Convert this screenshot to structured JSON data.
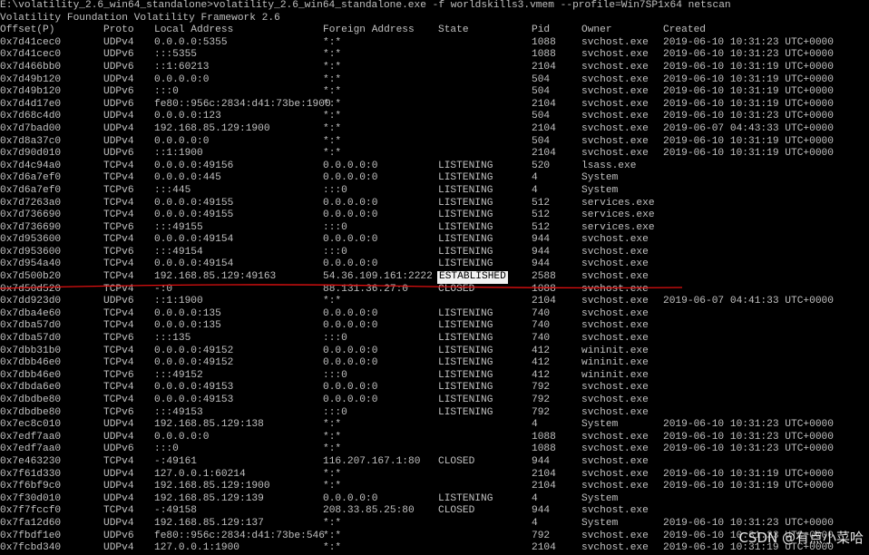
{
  "command": "E:\\volatility_2.6_win64_standalone>volatility_2.6_win64_standalone.exe -f worldskills3.vmem --profile=Win7SP1x64 netscan",
  "banner": "Volatility Foundation Volatility Framework 2.6",
  "headers": [
    "Offset(P)",
    "Proto",
    "Local Address",
    "Foreign Address",
    "State",
    "Pid",
    "Owner",
    "Created"
  ],
  "rows": [
    [
      "0x7d41cec0",
      "UDPv4",
      "0.0.0.0:5355",
      "*:*",
      "",
      "1088",
      "svchost.exe",
      "2019-06-10 10:31:23 UTC+0000"
    ],
    [
      "0x7d41cec0",
      "UDPv6",
      ":::5355",
      "*:*",
      "",
      "1088",
      "svchost.exe",
      "2019-06-10 10:31:23 UTC+0000"
    ],
    [
      "0x7d466bb0",
      "UDPv6",
      "::1:60213",
      "*:*",
      "",
      "2104",
      "svchost.exe",
      "2019-06-10 10:31:19 UTC+0000"
    ],
    [
      "0x7d49b120",
      "UDPv4",
      "0.0.0.0:0",
      "*:*",
      "",
      "504",
      "svchost.exe",
      "2019-06-10 10:31:19 UTC+0000"
    ],
    [
      "0x7d49b120",
      "UDPv6",
      ":::0",
      "*:*",
      "",
      "504",
      "svchost.exe",
      "2019-06-10 10:31:19 UTC+0000"
    ],
    [
      "0x7d4d17e0",
      "UDPv6",
      "fe80::956c:2834:d41:73be:1900",
      "*:*",
      "",
      "2104",
      "svchost.exe",
      "2019-06-10 10:31:19 UTC+0000"
    ],
    [
      "0x7d68c4d0",
      "UDPv4",
      "0.0.0.0:123",
      "*:*",
      "",
      "504",
      "svchost.exe",
      "2019-06-10 10:31:23 UTC+0000"
    ],
    [
      "0x7d7bad00",
      "UDPv4",
      "192.168.85.129:1900",
      "*:*",
      "",
      "2104",
      "svchost.exe",
      "2019-06-07 04:43:33 UTC+0000"
    ],
    [
      "0x7d8a37c0",
      "UDPv4",
      "0.0.0.0:0",
      "*:*",
      "",
      "504",
      "svchost.exe",
      "2019-06-10 10:31:19 UTC+0000"
    ],
    [
      "0x7d90d010",
      "UDPv6",
      "::1:1900",
      "*:*",
      "",
      "2104",
      "svchost.exe",
      "2019-06-10 10:31:19 UTC+0000"
    ],
    [
      "0x7d4c94a0",
      "TCPv4",
      "0.0.0.0:49156",
      "0.0.0.0:0",
      "LISTENING",
      "520",
      "lsass.exe",
      ""
    ],
    [
      "0x7d6a7ef0",
      "TCPv4",
      "0.0.0.0:445",
      "0.0.0.0:0",
      "LISTENING",
      "4",
      "System",
      ""
    ],
    [
      "0x7d6a7ef0",
      "TCPv6",
      ":::445",
      ":::0",
      "LISTENING",
      "4",
      "System",
      ""
    ],
    [
      "0x7d7263a0",
      "TCPv4",
      "0.0.0.0:49155",
      "0.0.0.0:0",
      "LISTENING",
      "512",
      "services.exe",
      ""
    ],
    [
      "0x7d736690",
      "TCPv4",
      "0.0.0.0:49155",
      "0.0.0.0:0",
      "LISTENING",
      "512",
      "services.exe",
      ""
    ],
    [
      "0x7d736690",
      "TCPv6",
      ":::49155",
      ":::0",
      "LISTENING",
      "512",
      "services.exe",
      ""
    ],
    [
      "0x7d953600",
      "TCPv4",
      "0.0.0.0:49154",
      "0.0.0.0:0",
      "LISTENING",
      "944",
      "svchost.exe",
      ""
    ],
    [
      "0x7d953600",
      "TCPv6",
      ":::49154",
      ":::0",
      "LISTENING",
      "944",
      "svchost.exe",
      ""
    ],
    [
      "0x7d954a40",
      "TCPv4",
      "0.0.0.0:49154",
      "0.0.0.0:0",
      "LISTENING",
      "944",
      "svchost.exe",
      ""
    ],
    [
      "0x7d500b20",
      "TCPv4",
      "192.168.85.129:49163",
      "54.36.109.161:2222",
      "ESTABLISHED",
      "2588",
      "svchost.exe",
      ""
    ],
    [
      "0x7d50d520",
      "TCPv4",
      "-:0",
      "88.131.36.27:0",
      "CLOSED",
      "1088",
      "svchost.exe",
      ""
    ],
    [
      "0x7dd923d0",
      "UDPv6",
      "::1:1900",
      "*:*",
      "",
      "2104",
      "svchost.exe",
      "2019-06-07 04:41:33 UTC+0000"
    ],
    [
      "0x7dba4e60",
      "TCPv4",
      "0.0.0.0:135",
      "0.0.0.0:0",
      "LISTENING",
      "740",
      "svchost.exe",
      ""
    ],
    [
      "0x7dba57d0",
      "TCPv4",
      "0.0.0.0:135",
      "0.0.0.0:0",
      "LISTENING",
      "740",
      "svchost.exe",
      ""
    ],
    [
      "0x7dba57d0",
      "TCPv6",
      ":::135",
      ":::0",
      "LISTENING",
      "740",
      "svchost.exe",
      ""
    ],
    [
      "0x7dbb31b0",
      "TCPv4",
      "0.0.0.0:49152",
      "0.0.0.0:0",
      "LISTENING",
      "412",
      "wininit.exe",
      ""
    ],
    [
      "0x7dbb46e0",
      "TCPv4",
      "0.0.0.0:49152",
      "0.0.0.0:0",
      "LISTENING",
      "412",
      "wininit.exe",
      ""
    ],
    [
      "0x7dbb46e0",
      "TCPv6",
      ":::49152",
      ":::0",
      "LISTENING",
      "412",
      "wininit.exe",
      ""
    ],
    [
      "0x7dbda6e0",
      "TCPv4",
      "0.0.0.0:49153",
      "0.0.0.0:0",
      "LISTENING",
      "792",
      "svchost.exe",
      ""
    ],
    [
      "0x7dbdbe80",
      "TCPv4",
      "0.0.0.0:49153",
      "0.0.0.0:0",
      "LISTENING",
      "792",
      "svchost.exe",
      ""
    ],
    [
      "0x7dbdbe80",
      "TCPv6",
      ":::49153",
      ":::0",
      "LISTENING",
      "792",
      "svchost.exe",
      ""
    ],
    [
      "0x7ec8c010",
      "UDPv4",
      "192.168.85.129:138",
      "*:*",
      "",
      "4",
      "System",
      "2019-06-10 10:31:23 UTC+0000"
    ],
    [
      "0x7edf7aa0",
      "UDPv4",
      "0.0.0.0:0",
      "*:*",
      "",
      "1088",
      "svchost.exe",
      "2019-06-10 10:31:23 UTC+0000"
    ],
    [
      "0x7edf7aa0",
      "UDPv6",
      ":::0",
      "*:*",
      "",
      "1088",
      "svchost.exe",
      "2019-06-10 10:31:23 UTC+0000"
    ],
    [
      "0x7e463230",
      "TCPv4",
      "-:49161",
      "116.207.167.1:80",
      "CLOSED",
      "944",
      "svchost.exe",
      ""
    ],
    [
      "0x7f61d330",
      "UDPv4",
      "127.0.0.1:60214",
      "*:*",
      "",
      "2104",
      "svchost.exe",
      "2019-06-10 10:31:19 UTC+0000"
    ],
    [
      "0x7f6bf9c0",
      "UDPv4",
      "192.168.85.129:1900",
      "*:*",
      "",
      "2104",
      "svchost.exe",
      "2019-06-10 10:31:19 UTC+0000"
    ],
    [
      "0x7f30d010",
      "UDPv4",
      "192.168.85.129:139",
      "0.0.0.0:0",
      "LISTENING",
      "4",
      "System",
      ""
    ],
    [
      "0x7f7fccf0",
      "TCPv4",
      "-:49158",
      "208.33.85.25:80",
      "CLOSED",
      "944",
      "svchost.exe",
      ""
    ],
    [
      "0x7fa12d60",
      "UDPv4",
      "192.168.85.129:137",
      "*:*",
      "",
      "4",
      "System",
      "2019-06-10 10:31:23 UTC+0000"
    ],
    [
      "0x7fbdf1e0",
      "UDPv6",
      "fe80::956c:2834:d41:73be:546",
      "*:*",
      "",
      "792",
      "svchost.exe",
      "2019-06-10 10:31:23 UTC+0000"
    ],
    [
      "0x7fcbd340",
      "UDPv4",
      "127.0.0.1:1900",
      "*:*",
      "",
      "2104",
      "svchost.exe",
      "2019-06-10 10:31:19 UTC+0000"
    ]
  ],
  "highlighted_state": "ESTABLISHED",
  "watermark": "CSDN @有点小菜哈",
  "colors": {
    "background": "#000000",
    "text": "#c0c0c0",
    "highlight_bg": "#f2f2f2",
    "underline": "#e01010"
  }
}
